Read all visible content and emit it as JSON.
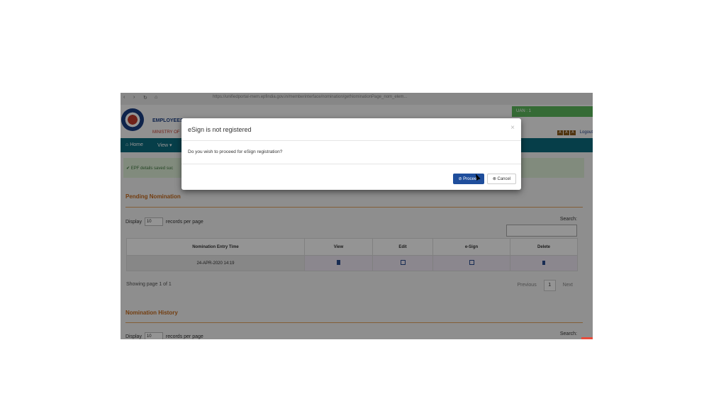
{
  "browser": {
    "nav_glyphs": [
      "‹",
      "›",
      "↻",
      "⌂"
    ],
    "url": "https://unifiedportal-mem.epfindia.gov.in/memberinterface/nomination/getNominationPage_nom_elem..."
  },
  "header": {
    "org_title": "EMPLOYEES",
    "org_subtitle": "MINISTRY OF",
    "uan_label": "UAN : 1",
    "font_buttons": [
      "A",
      "A",
      "A"
    ],
    "logout": "Logout"
  },
  "nav": {
    "home": "Home",
    "view": "View ▾"
  },
  "alert": {
    "text": "EPF details saved suc"
  },
  "pending": {
    "title": "Pending Nomination",
    "display_label": "Display",
    "display_value": "10",
    "display_suffix": "records per page",
    "search_label": "Search:",
    "columns": [
      "Nomination Entry Time",
      "View",
      "Edit",
      "e-Sign",
      "Delete"
    ],
    "rows": [
      {
        "entry_time": "24-APR-2020 14:19"
      }
    ],
    "showing": "Showing page 1 of 1",
    "prev": "Previous",
    "page": "1",
    "next": "Next"
  },
  "history": {
    "title": "Nomination History",
    "display_label": "Display",
    "display_value": "10",
    "display_suffix": "records per page",
    "search_label": "Search:"
  },
  "modal": {
    "title": "eSign is not registered",
    "close": "×",
    "body": "Do you wish to proceed for eSign registration?",
    "proceed": "⊘ Proceed",
    "cancel": "⊗ Cancel"
  },
  "colors": {
    "nav": "#0b6b7f",
    "accent": "#c66b1d",
    "primary_button": "#1f4e9c",
    "alert_bg": "#dff0d8"
  }
}
